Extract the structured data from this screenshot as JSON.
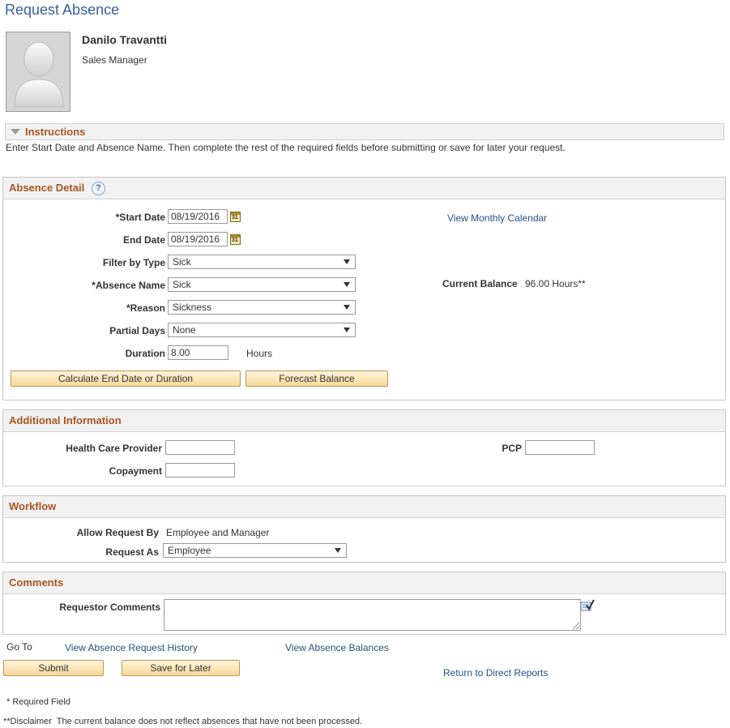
{
  "page": {
    "title": "Request Absence"
  },
  "employee": {
    "name": "Danilo Travantti",
    "job_title": "Sales Manager"
  },
  "instructions": {
    "label": "Instructions",
    "text": "Enter Start Date and Absence Name. Then complete the rest of the required fields before submitting or save for later your request."
  },
  "absence_detail": {
    "title": "Absence Detail",
    "help": "?",
    "start_date_label": "*Start Date",
    "start_date": "08/19/2016",
    "end_date_label": "End Date",
    "end_date": "08/19/2016",
    "view_calendar_link": "View Monthly Calendar",
    "filter_type_label": "Filter by Type",
    "filter_type": "Sick",
    "absence_name_label": "*Absence Name",
    "absence_name": "Sick",
    "current_balance_label": "Current Balance",
    "current_balance": "96.00 Hours**",
    "reason_label": "*Reason",
    "reason": "Sickness",
    "partial_days_label": "Partial Days",
    "partial_days": "None",
    "duration_label": "Duration",
    "duration": "8.00",
    "duration_unit": "Hours",
    "calculate_button": "Calculate End Date or Duration",
    "forecast_button": "Forecast Balance"
  },
  "additional_info": {
    "title": "Additional Information",
    "health_care_provider_label": "Health Care Provider",
    "health_care_provider": "",
    "pcp_label": "PCP",
    "pcp": "",
    "copayment_label": "Copayment",
    "copayment": ""
  },
  "workflow": {
    "title": "Workflow",
    "allow_request_by_label": "Allow Request By",
    "allow_request_by": "Employee and Manager",
    "request_as_label": "Request As",
    "request_as": "Employee"
  },
  "comments": {
    "title": "Comments",
    "requestor_comments_label": "Requestor Comments",
    "requestor_comments": ""
  },
  "goto": {
    "label": "Go To",
    "history_link": "View Absence Request History",
    "balances_link": "View Absence Balances"
  },
  "actions": {
    "submit": "Submit",
    "save_later": "Save for Later",
    "return_link": "Return to Direct Reports"
  },
  "footer": {
    "required": "* Required Field",
    "disclaimer": "**Disclaimer  The current balance does not reflect absences that have not been processed."
  },
  "colors": {
    "title_blue": "#3a62a0",
    "section_title": "#a8551f",
    "link": "#24508a",
    "button_top": "#fff5dc",
    "button_bottom": "#f7d898"
  },
  "icons": {
    "calendar": "calendar-icon",
    "help": "help-icon",
    "dropdown": "chevron-down-icon",
    "spell_check": "spell-check-icon",
    "collapse": "triangle-down-icon",
    "photo": "person-silhouette-icon"
  }
}
